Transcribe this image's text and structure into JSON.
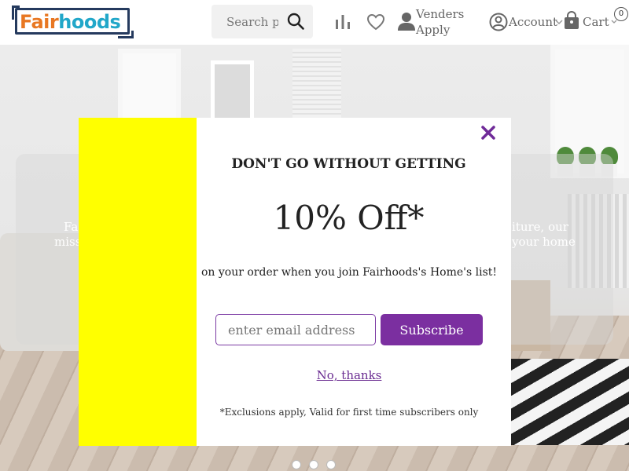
{
  "header": {
    "logo": {
      "part1": "Fair",
      "part2": "hoods"
    },
    "search_placeholder": "Search products",
    "venders_line1": "Venders",
    "venders_line2": "Apply",
    "account_label": "Account",
    "cart_label": "Cart",
    "cart_count": "0",
    "icons": [
      "search-icon",
      "compare-icon",
      "heart-icon",
      "person-icon",
      "account-icon",
      "chevron-down-icon",
      "shopping-bag-icon"
    ]
  },
  "hero": {
    "left_line1": "Fa",
    "left_line2": "miss",
    "right_line1": "iture, our",
    "right_line2": "your home",
    "slides": 3
  },
  "popup": {
    "heading": "DON'T GO WITHOUT GETTING",
    "offer": "10% Off*",
    "subtext": "on your order when you join Fairhoods's Home's list!",
    "email_placeholder": "enter email address",
    "subscribe_label": "Subscribe",
    "decline_label": "No, thanks",
    "fineprint": "*Exclusions apply, Valid for first time subscribers only",
    "close_icon": "close-icon",
    "colors": {
      "side_panel": "#ffff00",
      "accent": "#7b2fa0"
    }
  }
}
